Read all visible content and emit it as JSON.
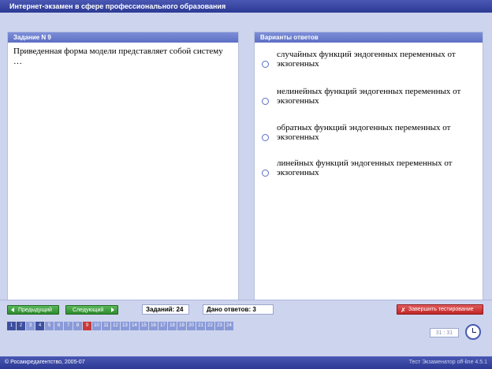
{
  "app": {
    "title": "Интернет-экзамен в сфере профессионального образования"
  },
  "question": {
    "header": "Задание N 9",
    "text": "Приведенная форма модели представляет собой систему …"
  },
  "answers": {
    "header": "Варианты ответов",
    "options": [
      "случайных функций эндогенных переменных от экзогенных",
      "нелинейных функций эндогенных переменных от экзогенных",
      "обратных функций эндогенных переменных от экзогенных",
      "линейных функций эндогенных переменных от экзогенных"
    ]
  },
  "controls": {
    "prev_label": "Предыдущий",
    "next_label": "Следующий",
    "tasks_label": "Заданий: 24",
    "answered_label": "Дано ответов: 3",
    "finish_label": "Завершить тестирование",
    "timer": "31 : 31"
  },
  "question_numbers": [
    "1",
    "2",
    "3",
    "4",
    "5",
    "6",
    "7",
    "8",
    "9",
    "10",
    "11",
    "12",
    "13",
    "14",
    "15",
    "16",
    "17",
    "18",
    "19",
    "20",
    "21",
    "22",
    "23",
    "24"
  ],
  "footer": {
    "left": "© Росаккредагентство, 2005-07",
    "right": "Тест Экзаменатор off-line 4.5.1"
  }
}
